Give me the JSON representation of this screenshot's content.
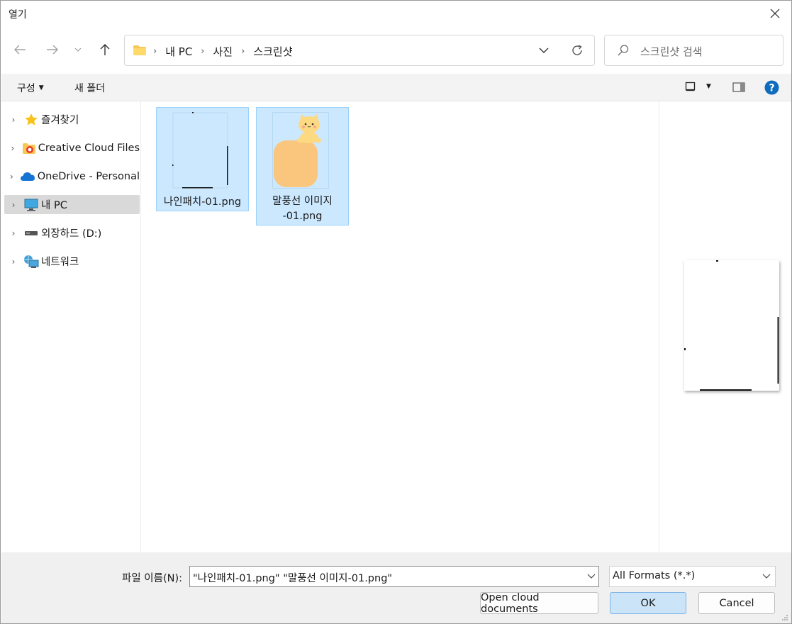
{
  "window": {
    "title": "열기"
  },
  "address": {
    "breadcrumbs": [
      "내 PC",
      "사진",
      "스크린샷"
    ]
  },
  "search": {
    "placeholder": "스크린샷 검색"
  },
  "toolbar": {
    "organize_label": "구성",
    "new_folder_label": "새 폴더"
  },
  "sidebar": {
    "items": [
      {
        "label": "즐겨찾기",
        "icon": "star-icon"
      },
      {
        "label": "Creative Cloud Files",
        "icon": "creative-cloud-icon"
      },
      {
        "label": "OneDrive - Personal",
        "icon": "onedrive-cloud-icon"
      },
      {
        "label": "내 PC",
        "icon": "monitor-icon",
        "selected": true
      },
      {
        "label": "외장하드 (D:)",
        "icon": "drive-icon"
      },
      {
        "label": "네트워크",
        "icon": "network-icon"
      }
    ]
  },
  "files": [
    {
      "name": "나인패치-01.png",
      "selected": true
    },
    {
      "name_line1": "말풍선 이미지",
      "name_line2": "-01.png",
      "selected": true
    }
  ],
  "bottom": {
    "filename_label": "파일 이름(N):",
    "filename_value": "\"나인패치-01.png\" \"말풍선 이미지-01.png\"",
    "filter_value": "All Formats (*.*)",
    "cloud_button_label": "Open cloud documents",
    "ok_label": "OK",
    "cancel_label": "Cancel"
  },
  "colors": {
    "selection_bg": "#cce8ff",
    "selection_border": "#99d1ff",
    "speech_bubble": "#fac67e",
    "cat": "#fdd982",
    "help_blue": "#0f6cbd"
  }
}
